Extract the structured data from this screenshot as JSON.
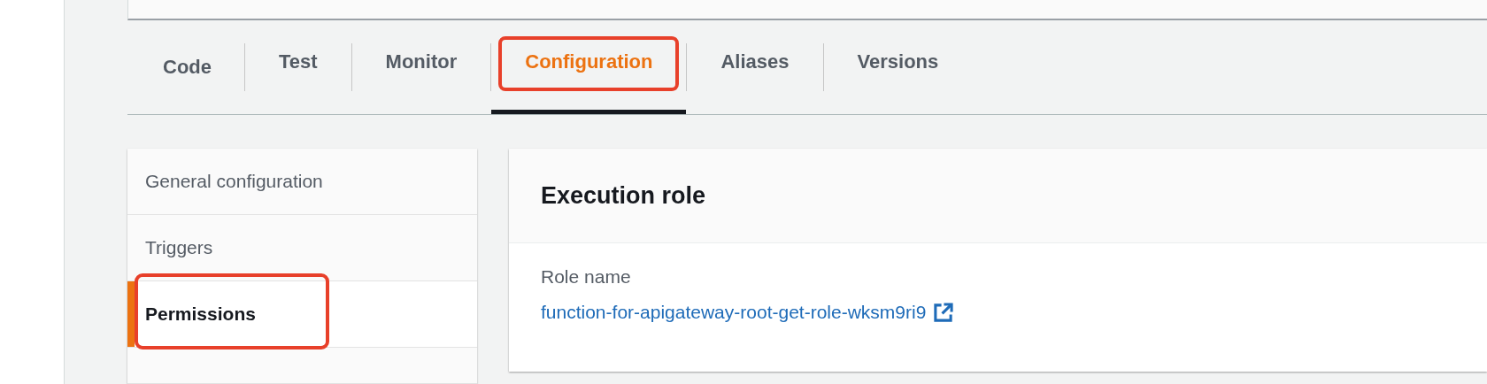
{
  "tabs": [
    {
      "label": "Code",
      "selected": false,
      "highlighted": false
    },
    {
      "label": "Test",
      "selected": false,
      "highlighted": false
    },
    {
      "label": "Monitor",
      "selected": false,
      "highlighted": false
    },
    {
      "label": "Configuration",
      "selected": true,
      "highlighted": true
    },
    {
      "label": "Aliases",
      "selected": false,
      "highlighted": false
    },
    {
      "label": "Versions",
      "selected": false,
      "highlighted": false
    }
  ],
  "sidebar": {
    "items": [
      {
        "label": "General configuration",
        "selected": false,
        "highlighted": false
      },
      {
        "label": "Triggers",
        "selected": false,
        "highlighted": false
      },
      {
        "label": "Permissions",
        "selected": true,
        "highlighted": true
      }
    ]
  },
  "panel": {
    "title": "Execution role",
    "field_label": "Role name",
    "role_link": "function-for-apigateway-root-get-role-wksm9ri9"
  }
}
